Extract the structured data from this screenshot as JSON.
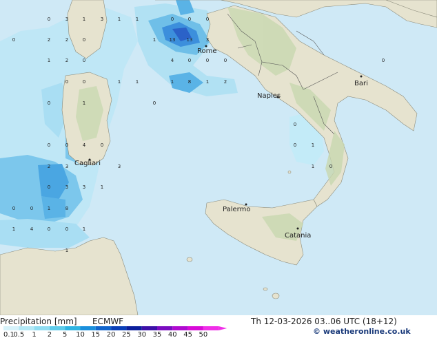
{
  "map": {
    "cities": [
      {
        "name": "Rome"
      },
      {
        "name": "Naples"
      },
      {
        "name": "Bari"
      },
      {
        "name": "Cagliari"
      },
      {
        "name": "Palermo"
      },
      {
        "name": "Catania"
      }
    ],
    "precip_values": [
      "0",
      "3",
      "1",
      "3",
      "1",
      "1",
      "0",
      "0",
      "0",
      "1",
      "13",
      "13",
      "3",
      "2",
      "2",
      "0",
      "1",
      "2",
      "0",
      "4",
      "0",
      "0",
      "0",
      "0",
      "0",
      "1",
      "1",
      "1",
      "8",
      "1",
      "2",
      "0",
      "1",
      "0",
      "0",
      "4",
      "0",
      "2",
      "3",
      "3",
      "0",
      "3",
      "3",
      "1",
      "0",
      "0",
      "1",
      "8",
      "1",
      "4",
      "0",
      "0",
      "1",
      "1",
      "0",
      "0",
      "1",
      "0",
      "0",
      "1",
      "0",
      "0"
    ]
  },
  "footer": {
    "title": "Precipitation [mm]",
    "model": "ECMWF",
    "datetime": "Th 12-03-2026 03..06 UTC (18+12)",
    "credit": "© weatheronline.co.uk",
    "scale_labels": [
      "0.1",
      "0.5",
      "1",
      "2",
      "5",
      "10",
      "15",
      "20",
      "25",
      "30",
      "35",
      "40",
      "45",
      "50"
    ],
    "scale_colors": [
      "#d7f3fb",
      "#b3e8f6",
      "#8fdcf1",
      "#5ecbea",
      "#2fb4e2",
      "#1a8fdc",
      "#1064cc",
      "#0a3fb8",
      "#0b1e9c",
      "#3c10a8",
      "#7a0cc0",
      "#b00ad0",
      "#d80ad8",
      "#f02ee8"
    ]
  }
}
